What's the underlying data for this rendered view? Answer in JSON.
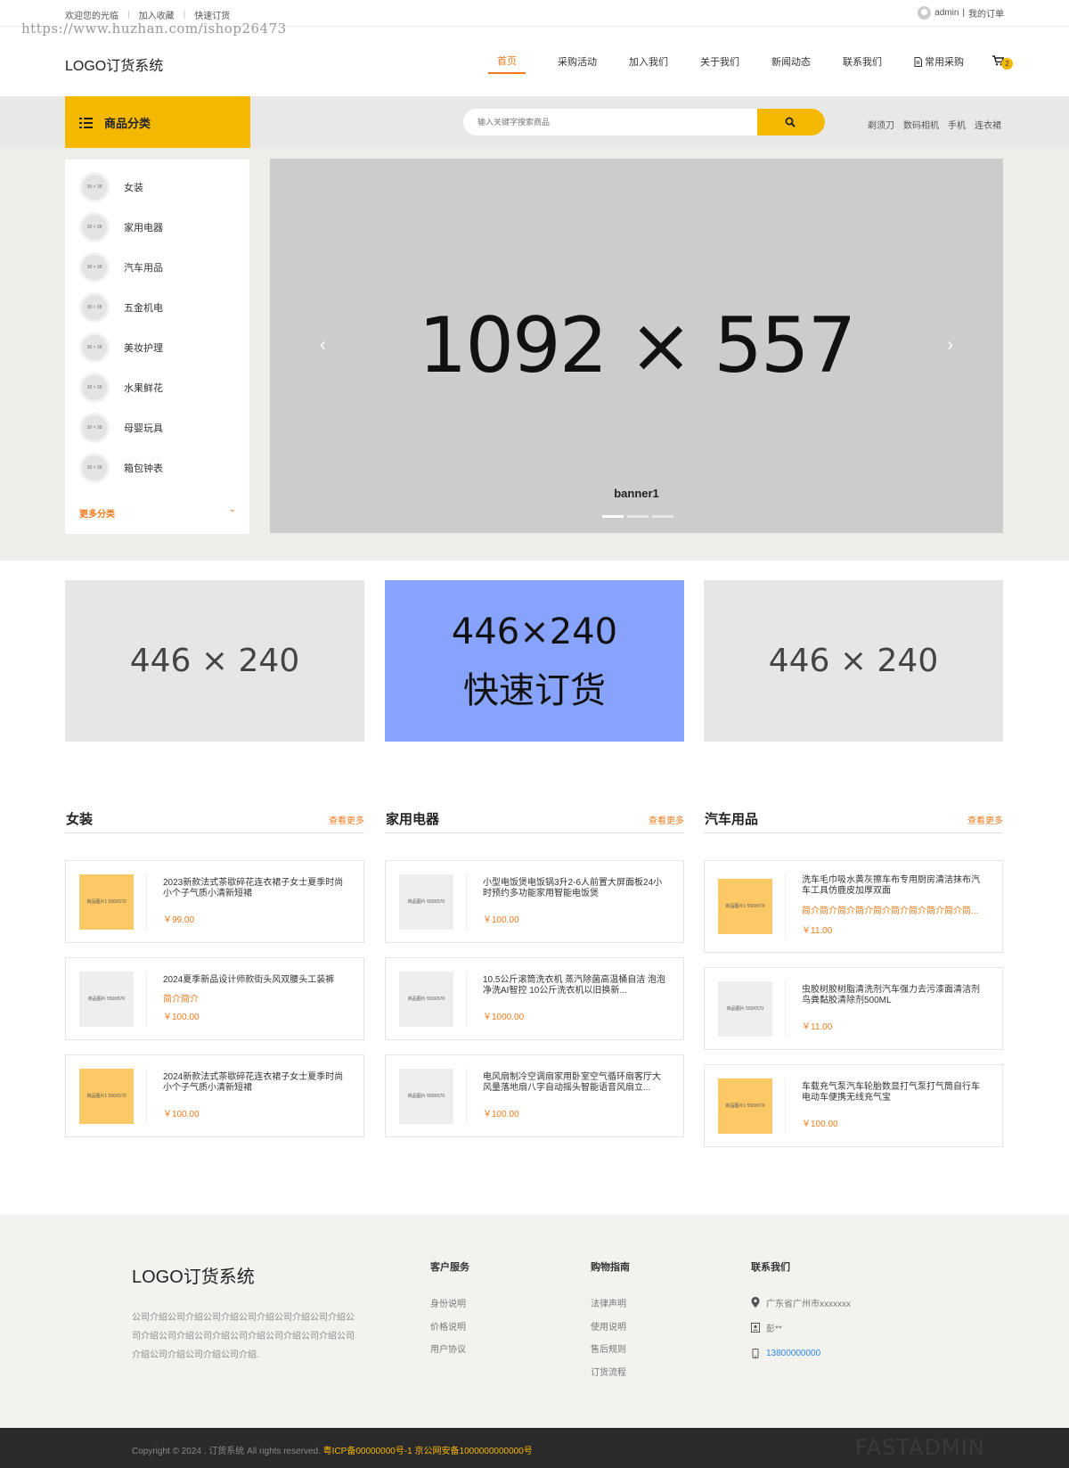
{
  "topbar": {
    "welcome": "欢迎您的光临",
    "bookmark": "加入收藏",
    "quick_order": "快速订货",
    "watermark": "https://www.huzhan.com/ishop26473",
    "username": "admin",
    "my_orders": "我的订单"
  },
  "header": {
    "logo": "LOGO订货系统",
    "nav": [
      "首页",
      "采购活动",
      "加入我们",
      "关于我们",
      "新闻动态",
      "联系我们",
      "常用采购"
    ],
    "cart_count": "2"
  },
  "catbar": {
    "title": "商品分类",
    "search_placeholder": "输入关键字搜索商品",
    "hot_keywords": [
      "剃须刀",
      "数码相机",
      "手机",
      "连衣裙"
    ]
  },
  "categories": {
    "thumb_text": "38 × 38",
    "items": [
      "女装",
      "家用电器",
      "汽车用品",
      "五金机电",
      "美妆护理",
      "水果鲜花",
      "母婴玩具",
      "箱包钟表"
    ],
    "more": "更多分类"
  },
  "banner": {
    "placeholder": "1092 × 557",
    "caption": "banner1",
    "slides": 3,
    "active_slide": 1
  },
  "promos": [
    {
      "lines": [
        "446 × 240"
      ]
    },
    {
      "lines": [
        "446×240",
        "快速订货"
      ]
    },
    {
      "lines": [
        "446 × 240"
      ]
    }
  ],
  "sections": [
    {
      "title": "女装",
      "more": "查看更多",
      "products": [
        {
          "name": "2023新款法式茶歇碎花连衣裙子女士夏季时尚小个子气质小清新短裙",
          "desc": "",
          "price": "￥99.00",
          "img_label": "商品图片1 550X570",
          "img_color": "y"
        },
        {
          "name": "2024夏季新品设计师款街头风双腰头工装裤",
          "desc": "简介简介",
          "price": "￥100.00",
          "img_label": "商品图片 550X570",
          "img_color": "g"
        },
        {
          "name": "2024新款法式茶歇碎花连衣裙子女士夏季时尚小个子气质小清新短裙",
          "desc": "",
          "price": "￥100.00",
          "img_label": "商品图片1 550X570",
          "img_color": "y"
        }
      ]
    },
    {
      "title": "家用电器",
      "more": "查看更多",
      "products": [
        {
          "name": "小型电饭煲电饭锅3升2-6人前置大屏面板24小时预约多功能家用智能电饭煲",
          "desc": "",
          "price": "￥100.00",
          "img_label": "商品图片 550X570",
          "img_color": "g"
        },
        {
          "name": "10.5公斤滚筒洗衣机 蒸汽除菌高温桶自洁 泡泡净洗AI智控 10公斤洗衣机以旧换新...",
          "desc": "",
          "price": "￥1000.00",
          "img_label": "商品图片 550X570",
          "img_color": "g"
        },
        {
          "name": "电风扇制冷空调扇家用卧室空气循环扇客厅大风量落地扇八字自动摇头智能语音风扇立...",
          "desc": "",
          "price": "￥100.00",
          "img_label": "商品图片 550X570",
          "img_color": "g"
        }
      ]
    },
    {
      "title": "汽车用品",
      "more": "查看更多",
      "products": [
        {
          "name": "洗车毛巾吸水黄灰擦车布专用厨房清洁抹布汽车工具仿鹿皮加厚双面",
          "desc": "简介简介简介简介简介简介简介简介简介简...",
          "price": "￥11.00",
          "img_label": "商品图片1 550X570",
          "img_color": "y"
        },
        {
          "name": "虫胶树胶树脂清洗剂汽车强力去污漆面清洁剂 鸟粪黏胶清除剂500ML",
          "desc": "",
          "price": "￥11.00",
          "img_label": "商品图片 550X570",
          "img_color": "g"
        },
        {
          "name": "车载充气泵汽车轮胎数显打气泵打气筒自行车电动车便携无线充气宝",
          "desc": "",
          "price": "￥100.00",
          "img_label": "商品图片1 550X570",
          "img_color": "y"
        }
      ]
    }
  ],
  "footer": {
    "logo": "LOGO订货系统",
    "intro": "公司介绍公司介绍公司介绍公司介绍公司介绍公司介绍公司介绍公司介绍公司介绍公司介绍公司介绍公司介绍公司介绍公司介绍公司介绍公司介绍.",
    "service_title": "客户服务",
    "service_links": [
      "身份说明",
      "价格说明",
      "用户协议"
    ],
    "guide_title": "购物指南",
    "guide_links": [
      "法律声明",
      "使用说明",
      "售后规则",
      "订货流程"
    ],
    "contact_title": "联系我们",
    "address": "广东省广州市xxxxxxx",
    "contact_person": "彭**",
    "phone": "13800000000"
  },
  "copyright": {
    "text": "Copyright © 2024 . 订货系统 All rights reserved.",
    "icp": "粤ICP备00000000号-1 京公网安备1000000000000号",
    "mark": "FASTADMIN"
  },
  "colors": {
    "accent": "#f5b800",
    "price": "#f07b1d",
    "link": "#2d8ae6"
  }
}
